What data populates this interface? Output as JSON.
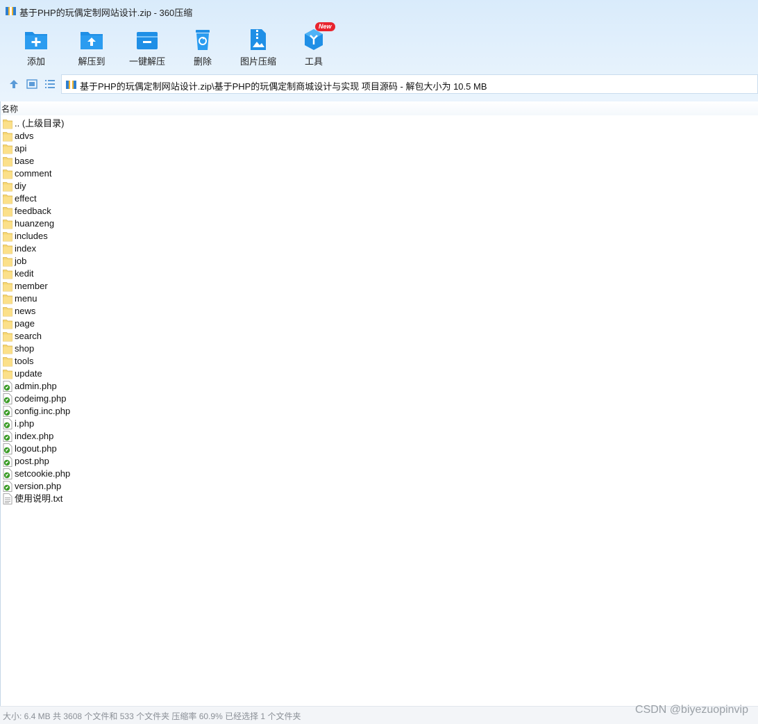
{
  "window": {
    "title": "基于PHP的玩偶定制网站设计.zip - 360压缩"
  },
  "toolbar": {
    "items": [
      {
        "label": "添加",
        "icon": "add-folder-icon"
      },
      {
        "label": "解压到",
        "icon": "extract-to-icon"
      },
      {
        "label": "一键解压",
        "icon": "one-click-extract-icon"
      },
      {
        "label": "删除",
        "icon": "recycle-bin-icon"
      },
      {
        "label": "图片压缩",
        "icon": "image-compress-icon"
      },
      {
        "label": "工具",
        "icon": "tools-cube-icon",
        "badge": "New"
      }
    ]
  },
  "address": {
    "path": "基于PHP的玩偶定制网站设计.zip\\基于PHP的玩偶定制商城设计与实现 项目源码 - 解包大小为 10.5 MB"
  },
  "list": {
    "column_name": "名称",
    "items": [
      {
        "name": ".. (上级目录)",
        "type": "folder"
      },
      {
        "name": "advs",
        "type": "folder"
      },
      {
        "name": "api",
        "type": "folder"
      },
      {
        "name": "base",
        "type": "folder"
      },
      {
        "name": "comment",
        "type": "folder"
      },
      {
        "name": "diy",
        "type": "folder"
      },
      {
        "name": "effect",
        "type": "folder"
      },
      {
        "name": "feedback",
        "type": "folder"
      },
      {
        "name": "huanzeng",
        "type": "folder"
      },
      {
        "name": "includes",
        "type": "folder"
      },
      {
        "name": "index",
        "type": "folder"
      },
      {
        "name": "job",
        "type": "folder"
      },
      {
        "name": "kedit",
        "type": "folder"
      },
      {
        "name": "member",
        "type": "folder"
      },
      {
        "name": "menu",
        "type": "folder"
      },
      {
        "name": "news",
        "type": "folder"
      },
      {
        "name": "page",
        "type": "folder"
      },
      {
        "name": "search",
        "type": "folder"
      },
      {
        "name": "shop",
        "type": "folder"
      },
      {
        "name": "tools",
        "type": "folder"
      },
      {
        "name": "update",
        "type": "folder"
      },
      {
        "name": "admin.php",
        "type": "php"
      },
      {
        "name": "codeimg.php",
        "type": "php"
      },
      {
        "name": "config.inc.php",
        "type": "php"
      },
      {
        "name": "i.php",
        "type": "php"
      },
      {
        "name": "index.php",
        "type": "php"
      },
      {
        "name": "logout.php",
        "type": "php"
      },
      {
        "name": "post.php",
        "type": "php"
      },
      {
        "name": "setcookie.php",
        "type": "php"
      },
      {
        "name": "version.php",
        "type": "php"
      },
      {
        "name": "使用说明.txt",
        "type": "txt"
      }
    ]
  },
  "status": {
    "text": "大小: 6.4 MB 共 3608 个文件和 533 个文件夹 压缩率 60.9% 已经选择 1 个文件夹"
  },
  "watermark": "CSDN @biyezuopinvip",
  "colors": {
    "accent_blue": "#1f8fe6",
    "folder_yellow": "#f7d774",
    "badge_red": "#e8242e"
  }
}
